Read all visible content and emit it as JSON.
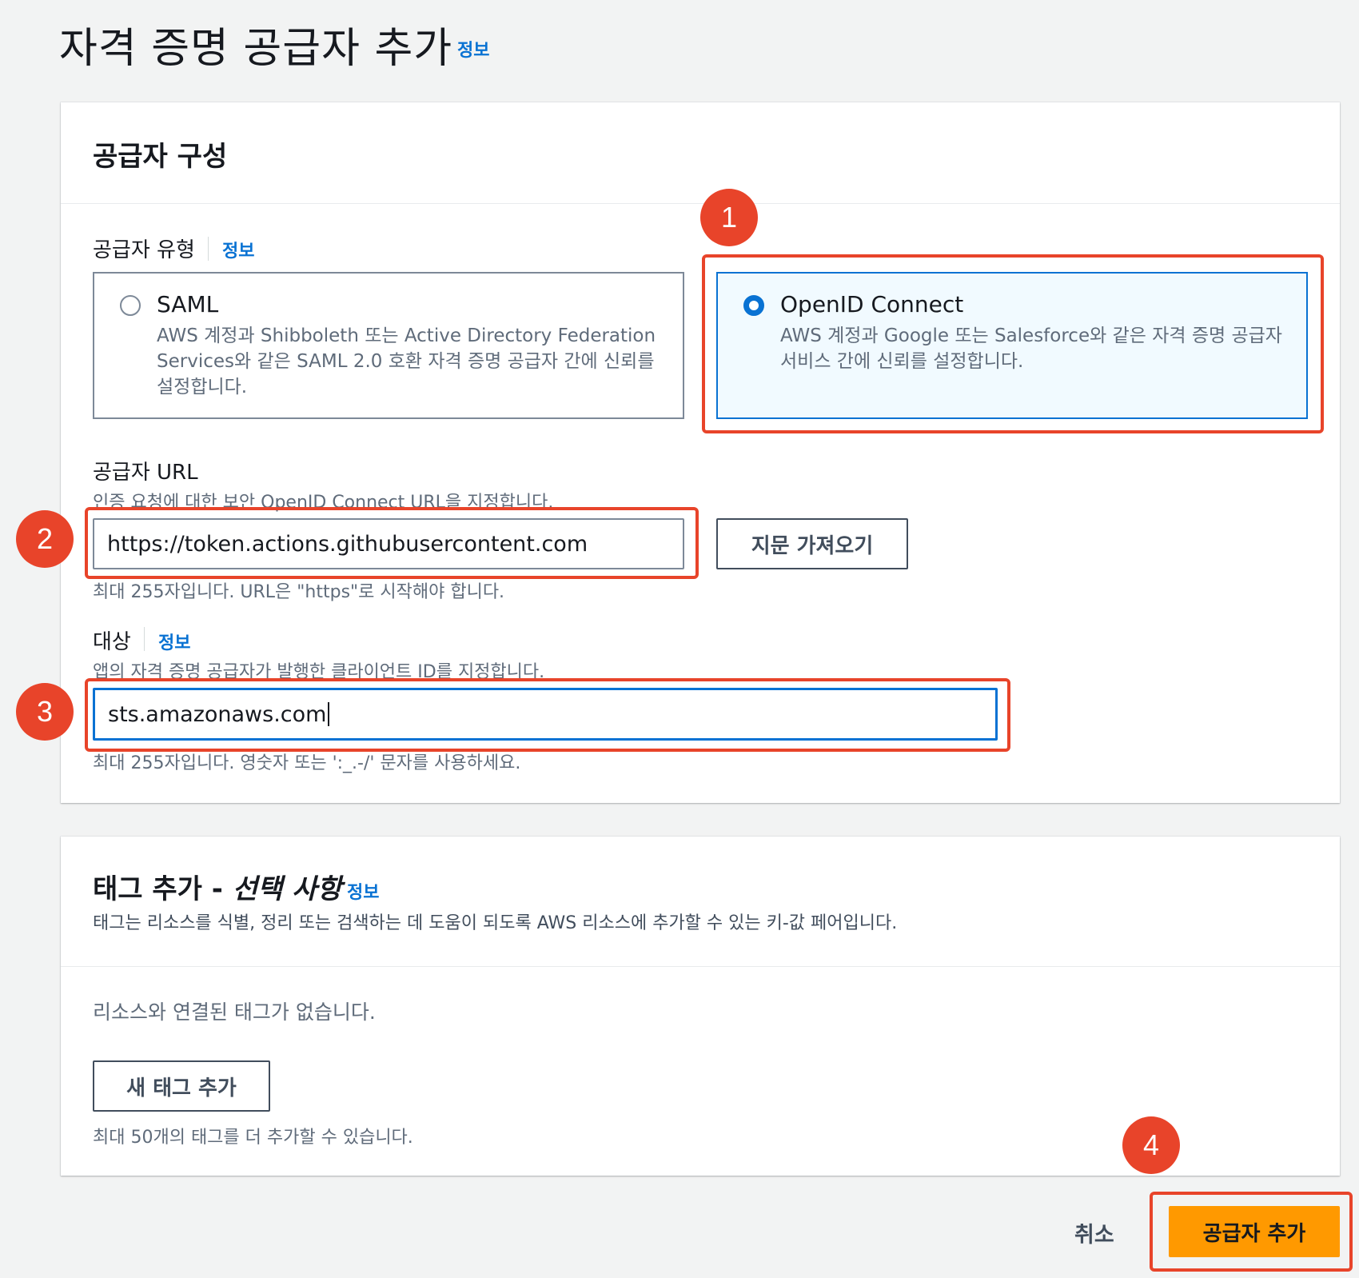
{
  "page": {
    "title": "자격 증명 공급자 추가",
    "title_info": "정보"
  },
  "provider_config": {
    "heading": "공급자 구성",
    "provider_type": {
      "label": "공급자 유형",
      "info": "정보",
      "options": [
        {
          "title": "SAML",
          "description": "AWS 계정과 Shibboleth 또는 Active Directory Federation Services와 같은 SAML 2.0 호환 자격 증명 공급자 간에 신뢰를 설정합니다.",
          "selected": false
        },
        {
          "title": "OpenID Connect",
          "description": "AWS 계정과 Google 또는 Salesforce와 같은 자격 증명 공급자 서비스 간에 신뢰를 설정합니다.",
          "selected": true
        }
      ]
    },
    "provider_url": {
      "label": "공급자 URL",
      "description": "인증 요청에 대한 보안 OpenID Connect URL을 지정합니다.",
      "value": "https://token.actions.githubusercontent.com",
      "constraint": "최대 255자입니다. URL은 \"https\"로 시작해야 합니다.",
      "fetch_button": "지문 가져오기"
    },
    "audience": {
      "label": "대상",
      "info": "정보",
      "description": "앱의 자격 증명 공급자가 발행한 클라이언트 ID를 지정합니다.",
      "value": "sts.amazonaws.com",
      "constraint": "최대 255자입니다. 영숫자 또는 ':_.-/' 문자를 사용하세요."
    }
  },
  "tags": {
    "heading_main": "태그 추가 - ",
    "heading_optional": "선택 사항",
    "info": "정보",
    "description": "태그는 리소스를 식별, 정리 또는 검색하는 데 도움이 되도록 AWS 리소스에 추가할 수 있는 키-값 페어입니다.",
    "empty_text": "리소스와 연결된 태그가 없습니다.",
    "add_button": "새 태그 추가",
    "limit_text": "최대 50개의 태그를 더 추가할 수 있습니다."
  },
  "footer": {
    "cancel": "취소",
    "submit": "공급자 추가"
  },
  "annotations": [
    "1",
    "2",
    "3",
    "4"
  ],
  "colors": {
    "accent": "#0972d3",
    "primary_button": "#ff9900",
    "annotation": "#e8442a"
  }
}
